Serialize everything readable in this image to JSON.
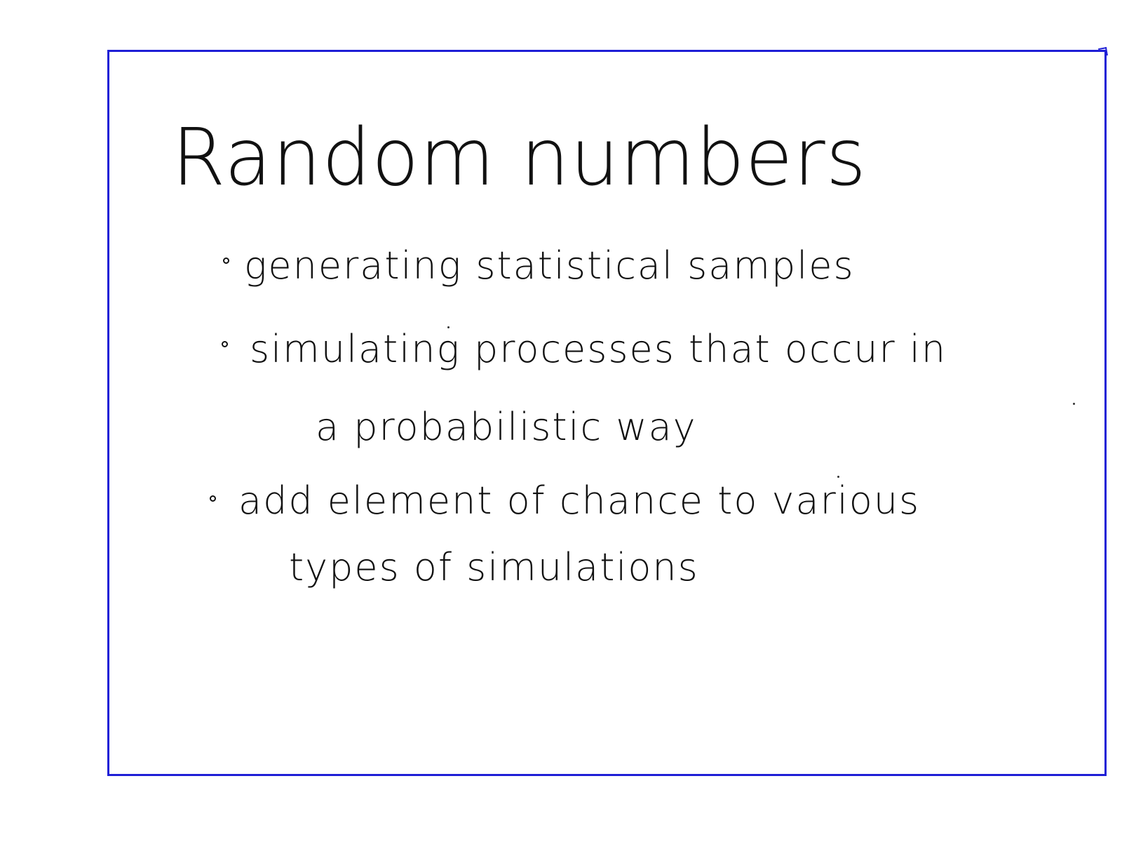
{
  "title": "Random numbers",
  "bullets": [
    {
      "lines": [
        "generating statistical samples"
      ]
    },
    {
      "lines": [
        "simulating processes that occur in",
        "a probabilistic way"
      ]
    },
    {
      "lines": [
        "add element of chance to various",
        "types of simulations"
      ]
    }
  ],
  "colors": {
    "frame": "#1f1fd6",
    "ink": "#111111"
  }
}
